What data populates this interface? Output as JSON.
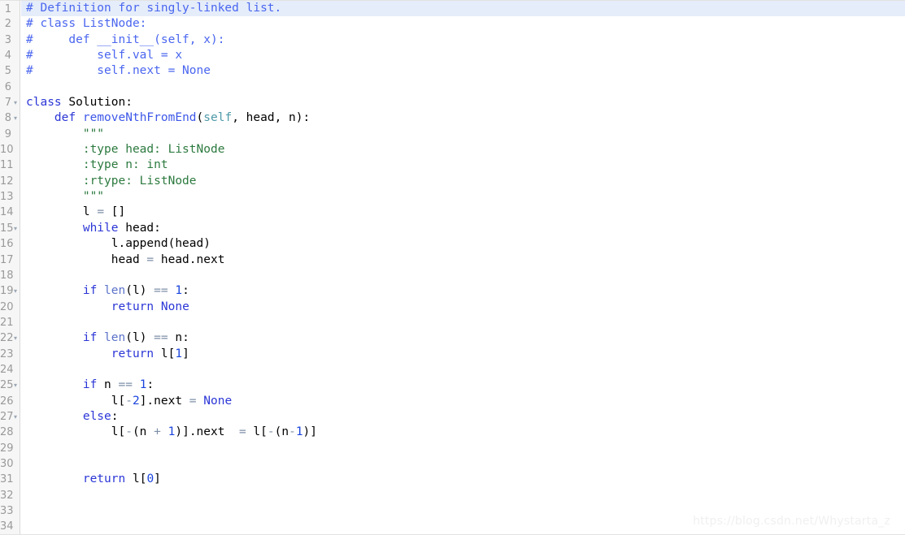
{
  "editor": {
    "language": "python",
    "total_lines": 34,
    "current_line": 1,
    "colors": {
      "background": "#ffffff",
      "gutter_background": "#f6f6f6",
      "gutter_text": "#9a9a9a",
      "current_line_highlight": "#e5edfa",
      "keyword": "#2b36d6",
      "function_name": "#3e58e8",
      "self_param": "#4e9aa8",
      "builtin": "#5b72c9",
      "number": "#1a44dd",
      "comment": "#4a66ef",
      "string": "#2c7a3f",
      "operator": "#7d8fa8",
      "plain_text": "#000000",
      "watermark": "#f0f0f0"
    },
    "fold_marker_glyph": "▾",
    "fold_lines": [
      7,
      8,
      15,
      19,
      22,
      25,
      27
    ],
    "line_numbers": [
      "1",
      "2",
      "3",
      "4",
      "5",
      "6",
      "7",
      "8",
      "9",
      "10",
      "11",
      "12",
      "13",
      "14",
      "15",
      "16",
      "17",
      "18",
      "19",
      "20",
      "21",
      "22",
      "23",
      "24",
      "25",
      "26",
      "27",
      "28",
      "29",
      "30",
      "31",
      "32",
      "33",
      "34"
    ],
    "lines": [
      {
        "n": 1,
        "text": "# Definition for singly-linked list."
      },
      {
        "n": 2,
        "text": "# class ListNode:"
      },
      {
        "n": 3,
        "text": "#     def __init__(self, x):"
      },
      {
        "n": 4,
        "text": "#         self.val = x"
      },
      {
        "n": 5,
        "text": "#         self.next = None"
      },
      {
        "n": 6,
        "text": ""
      },
      {
        "n": 7,
        "text": "class Solution:"
      },
      {
        "n": 8,
        "text": "    def removeNthFromEnd(self, head, n):"
      },
      {
        "n": 9,
        "text": "        \"\"\""
      },
      {
        "n": 10,
        "text": "        :type head: ListNode"
      },
      {
        "n": 11,
        "text": "        :type n: int"
      },
      {
        "n": 12,
        "text": "        :rtype: ListNode"
      },
      {
        "n": 13,
        "text": "        \"\"\""
      },
      {
        "n": 14,
        "text": "        l = []"
      },
      {
        "n": 15,
        "text": "        while head:"
      },
      {
        "n": 16,
        "text": "            l.append(head)"
      },
      {
        "n": 17,
        "text": "            head = head.next"
      },
      {
        "n": 18,
        "text": ""
      },
      {
        "n": 19,
        "text": "        if len(l) == 1:"
      },
      {
        "n": 20,
        "text": "            return None"
      },
      {
        "n": 21,
        "text": ""
      },
      {
        "n": 22,
        "text": "        if len(l) == n:"
      },
      {
        "n": 23,
        "text": "            return l[1]"
      },
      {
        "n": 24,
        "text": ""
      },
      {
        "n": 25,
        "text": "        if n == 1:"
      },
      {
        "n": 26,
        "text": "            l[-2].next = None"
      },
      {
        "n": 27,
        "text": "        else:"
      },
      {
        "n": 28,
        "text": "            l[-(n + 1)].next  = l[-(n-1)]"
      },
      {
        "n": 29,
        "text": ""
      },
      {
        "n": 30,
        "text": ""
      },
      {
        "n": 31,
        "text": "        return l[0]"
      },
      {
        "n": 32,
        "text": ""
      },
      {
        "n": 33,
        "text": ""
      },
      {
        "n": 34,
        "text": ""
      }
    ],
    "tokens": [
      [
        {
          "t": "# Definition for singly-linked list.",
          "c": "cmt"
        }
      ],
      [
        {
          "t": "# class ListNode:",
          "c": "cmt"
        }
      ],
      [
        {
          "t": "#     def __init__(self, x):",
          "c": "cmt"
        }
      ],
      [
        {
          "t": "#         self.val = x",
          "c": "cmt"
        }
      ],
      [
        {
          "t": "#         self.next = None",
          "c": "cmt"
        }
      ],
      [],
      [
        {
          "t": "class",
          "c": "kw"
        },
        {
          "t": " Solution:",
          "c": "pl"
        }
      ],
      [
        {
          "t": "    ",
          "c": "pl"
        },
        {
          "t": "def",
          "c": "kw"
        },
        {
          "t": " ",
          "c": "pl"
        },
        {
          "t": "removeNthFromEnd",
          "c": "fn"
        },
        {
          "t": "(",
          "c": "pl"
        },
        {
          "t": "self",
          "c": "self"
        },
        {
          "t": ", head, n):",
          "c": "pl"
        }
      ],
      [
        {
          "t": "        \"\"\"",
          "c": "str"
        }
      ],
      [
        {
          "t": "        :type head: ListNode",
          "c": "str"
        }
      ],
      [
        {
          "t": "        :type n: int",
          "c": "str"
        }
      ],
      [
        {
          "t": "        :rtype: ListNode",
          "c": "str"
        }
      ],
      [
        {
          "t": "        \"\"\"",
          "c": "str"
        }
      ],
      [
        {
          "t": "        l ",
          "c": "pl"
        },
        {
          "t": "=",
          "c": "op"
        },
        {
          "t": " []",
          "c": "pl"
        }
      ],
      [
        {
          "t": "        ",
          "c": "pl"
        },
        {
          "t": "while",
          "c": "kw"
        },
        {
          "t": " head:",
          "c": "pl"
        }
      ],
      [
        {
          "t": "            l.append(head)",
          "c": "pl"
        }
      ],
      [
        {
          "t": "            head ",
          "c": "pl"
        },
        {
          "t": "=",
          "c": "op"
        },
        {
          "t": " head.next",
          "c": "pl"
        }
      ],
      [],
      [
        {
          "t": "        ",
          "c": "pl"
        },
        {
          "t": "if",
          "c": "kw"
        },
        {
          "t": " ",
          "c": "pl"
        },
        {
          "t": "len",
          "c": "builtin"
        },
        {
          "t": "(l) ",
          "c": "pl"
        },
        {
          "t": "==",
          "c": "op"
        },
        {
          "t": " ",
          "c": "pl"
        },
        {
          "t": "1",
          "c": "num"
        },
        {
          "t": ":",
          "c": "pl"
        }
      ],
      [
        {
          "t": "            ",
          "c": "pl"
        },
        {
          "t": "return",
          "c": "kw"
        },
        {
          "t": " ",
          "c": "pl"
        },
        {
          "t": "None",
          "c": "const"
        }
      ],
      [],
      [
        {
          "t": "        ",
          "c": "pl"
        },
        {
          "t": "if",
          "c": "kw"
        },
        {
          "t": " ",
          "c": "pl"
        },
        {
          "t": "len",
          "c": "builtin"
        },
        {
          "t": "(l) ",
          "c": "pl"
        },
        {
          "t": "==",
          "c": "op"
        },
        {
          "t": " n:",
          "c": "pl"
        }
      ],
      [
        {
          "t": "            ",
          "c": "pl"
        },
        {
          "t": "return",
          "c": "kw"
        },
        {
          "t": " l[",
          "c": "pl"
        },
        {
          "t": "1",
          "c": "num"
        },
        {
          "t": "]",
          "c": "pl"
        }
      ],
      [],
      [
        {
          "t": "        ",
          "c": "pl"
        },
        {
          "t": "if",
          "c": "kw"
        },
        {
          "t": " n ",
          "c": "pl"
        },
        {
          "t": "==",
          "c": "op"
        },
        {
          "t": " ",
          "c": "pl"
        },
        {
          "t": "1",
          "c": "num"
        },
        {
          "t": ":",
          "c": "pl"
        }
      ],
      [
        {
          "t": "            l[",
          "c": "pl"
        },
        {
          "t": "-",
          "c": "op"
        },
        {
          "t": "2",
          "c": "num"
        },
        {
          "t": "].next ",
          "c": "pl"
        },
        {
          "t": "=",
          "c": "op"
        },
        {
          "t": " ",
          "c": "pl"
        },
        {
          "t": "None",
          "c": "const"
        }
      ],
      [
        {
          "t": "        ",
          "c": "pl"
        },
        {
          "t": "else",
          "c": "kw"
        },
        {
          "t": ":",
          "c": "pl"
        }
      ],
      [
        {
          "t": "            l[",
          "c": "pl"
        },
        {
          "t": "-",
          "c": "op"
        },
        {
          "t": "(n ",
          "c": "pl"
        },
        {
          "t": "+",
          "c": "op"
        },
        {
          "t": " ",
          "c": "pl"
        },
        {
          "t": "1",
          "c": "num"
        },
        {
          "t": ")].next  ",
          "c": "pl"
        },
        {
          "t": "=",
          "c": "op"
        },
        {
          "t": " l[",
          "c": "pl"
        },
        {
          "t": "-",
          "c": "op"
        },
        {
          "t": "(n",
          "c": "pl"
        },
        {
          "t": "-",
          "c": "op"
        },
        {
          "t": "1",
          "c": "num"
        },
        {
          "t": ")]",
          "c": "pl"
        }
      ],
      [],
      [],
      [
        {
          "t": "        ",
          "c": "pl"
        },
        {
          "t": "return",
          "c": "kw"
        },
        {
          "t": " l[",
          "c": "pl"
        },
        {
          "t": "0",
          "c": "num"
        },
        {
          "t": "]",
          "c": "pl"
        }
      ],
      [],
      [],
      []
    ]
  },
  "watermark": {
    "text": "https://blog.csdn.net/Whystarta_z"
  }
}
